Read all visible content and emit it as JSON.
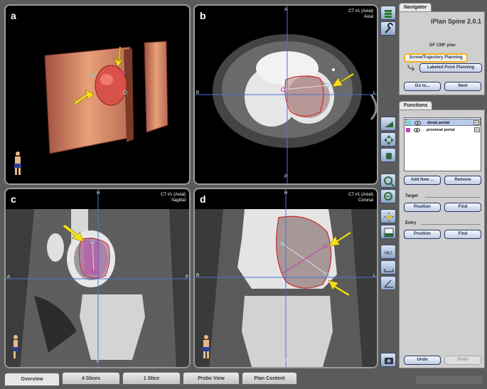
{
  "viewports": {
    "a": {
      "letter": "a"
    },
    "b": {
      "letter": "b",
      "info_line1": "CT #1 (Axial)",
      "info_line2": "Axial",
      "top": "A",
      "bottom": "P",
      "left": "R",
      "right": "L"
    },
    "c": {
      "letter": "c",
      "info_line1": "CT #1 (Axial)",
      "info_line2": "Sagittal",
      "top": "H",
      "bottom": "F",
      "left": "A",
      "right": "P"
    },
    "d": {
      "letter": "d",
      "info_line1": "CT #1 (Axial)",
      "info_line2": "Coronal",
      "top": "H",
      "bottom": "F",
      "left": "R",
      "right": "L"
    }
  },
  "navigator": {
    "tab_label": "Navigator",
    "app_title": "iPlan Spine 2.0.1",
    "plan_name": "DF CMF plan",
    "step_screw": "Screw/Trajectory Planning",
    "step_labeled": "Labeled Point Planning",
    "goto_label": "Go to...",
    "next_label": "Next"
  },
  "functions": {
    "tab_label": "Functions",
    "items": [
      {
        "label": "distal portal",
        "color": "#7fd3d3",
        "dots": "..."
      },
      {
        "label": "proximal portal",
        "color": "#c040b0",
        "dots": "..."
      }
    ],
    "add_new_label": "Add New ...",
    "remove_label": "Remove",
    "target_label": "Target",
    "target_position": "Position",
    "target_find": "Find",
    "entry_label": "Entry",
    "entry_position": "Position",
    "entry_find": "Find",
    "undo_label": "Undo",
    "redo_label": "Redo"
  },
  "bottom_tabs": [
    "Overview",
    "4 Slices",
    "1 Slice",
    "Probe View",
    "Plan Content"
  ],
  "colors": {
    "crosshair": "#4a72d8",
    "arrow": "#f5e01a",
    "tumor_outline": "#d02828",
    "selection": "#f2b21c"
  },
  "toolbar_icons": [
    "layers-icon",
    "wrench-icon",
    "slice-icon",
    "pan-icon",
    "hand-icon",
    "zoom-in-icon",
    "zoom-out-icon",
    "brightness-icon",
    "window-level-icon",
    "hu-icon",
    "measure-icon",
    "angle-icon",
    "camera-icon"
  ]
}
